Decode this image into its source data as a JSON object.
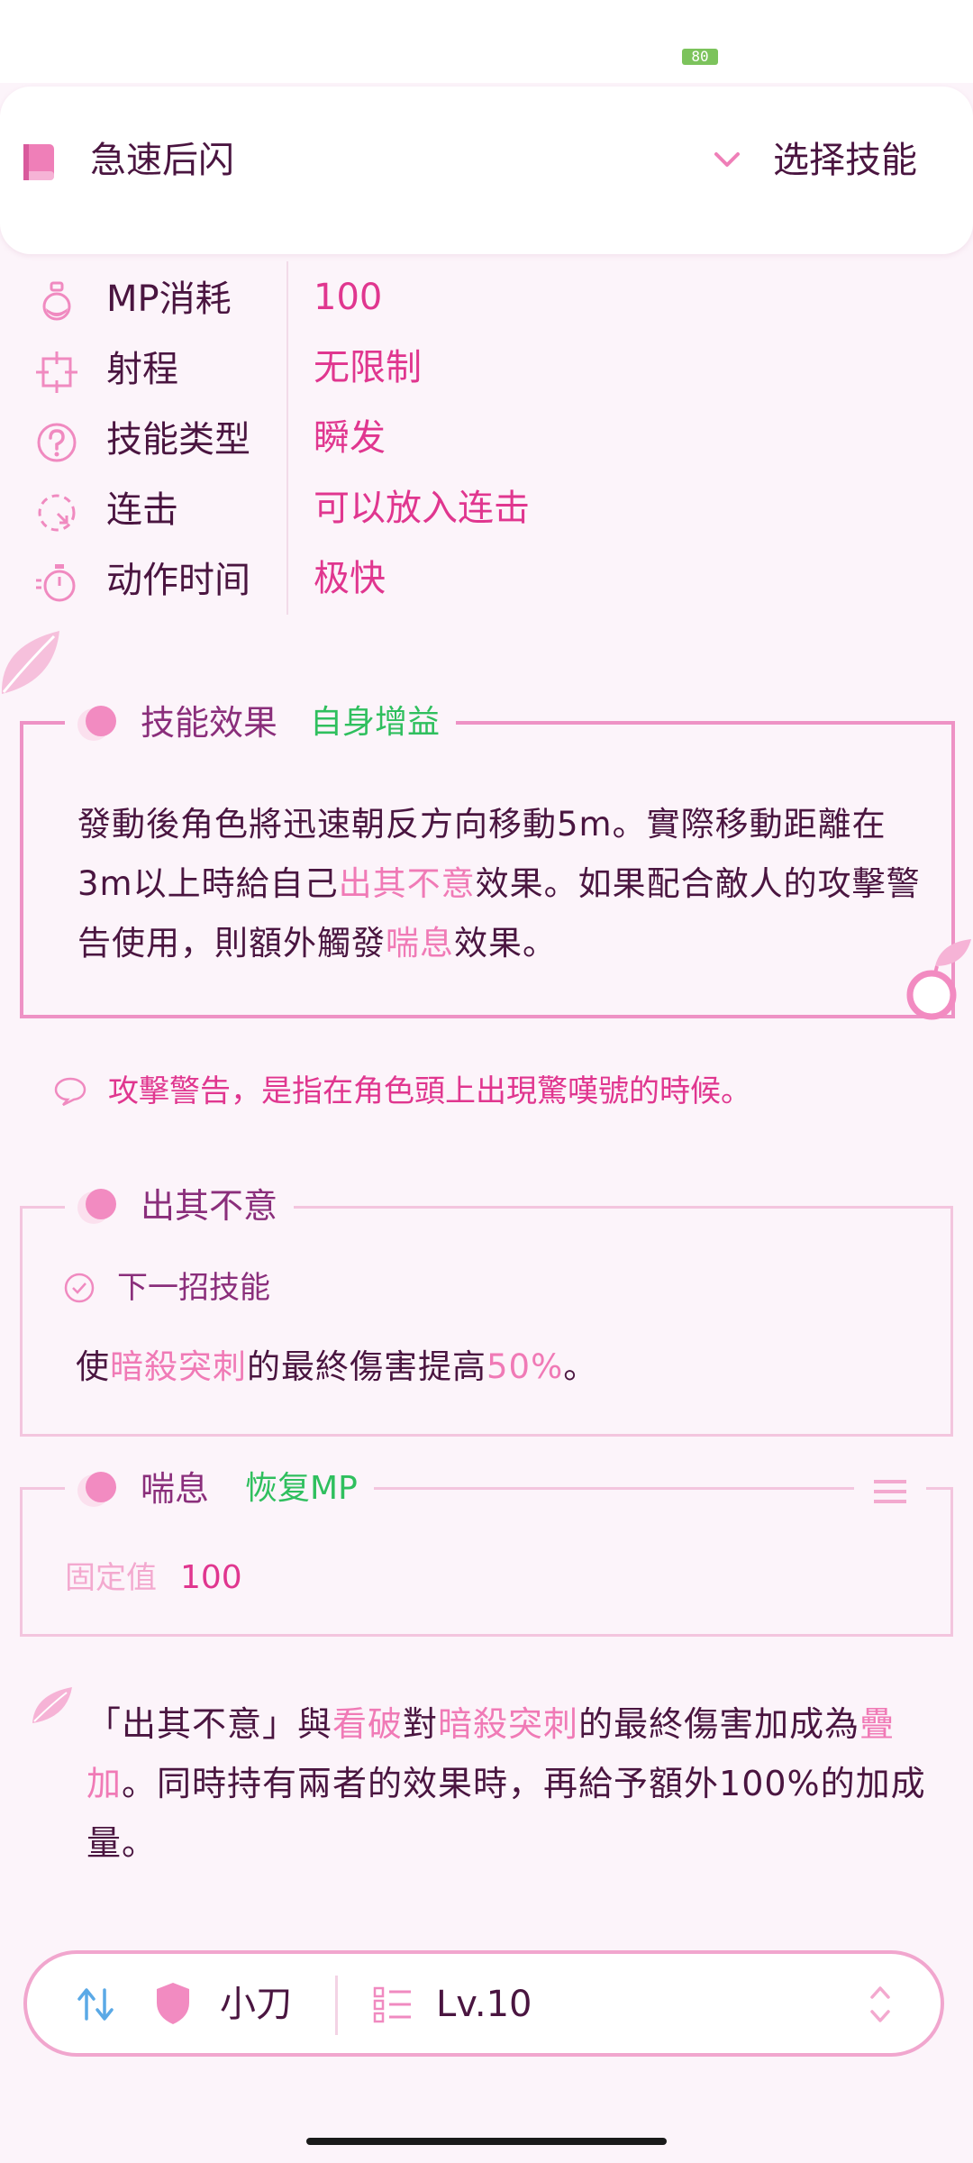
{
  "status": {
    "battery": "80"
  },
  "header": {
    "skill_name": "急速后闪",
    "select_label": "选择技能"
  },
  "properties": [
    {
      "icon": "potion-icon",
      "label": "MP消耗",
      "value": "100"
    },
    {
      "icon": "range-icon",
      "label": "射程",
      "value": "无限制"
    },
    {
      "icon": "question-icon",
      "label": "技能类型",
      "value": "瞬发"
    },
    {
      "icon": "combo-icon",
      "label": "连击",
      "value": "可以放入连击"
    },
    {
      "icon": "stopwatch-icon",
      "label": "动作时间",
      "value": "极快"
    }
  ],
  "effect": {
    "title": "技能效果",
    "tag": "自身增益",
    "text_parts": [
      "發動後角色將迅速朝反方向移動5m。實際移動距離在3m以上時給自己",
      "出其不意",
      "效果。如果配合敵人的攻擊警告使用，則額外觸發",
      "喘息",
      "效果。"
    ]
  },
  "note": "攻擊警告，是指在角色頭上出現驚嘆號的時候。",
  "surprise": {
    "title": "出其不意",
    "condition": "下一招技能",
    "text_parts": [
      "使",
      "暗殺突刺",
      "的最終傷害提高",
      "50%",
      "。"
    ]
  },
  "breather": {
    "title": "喘息",
    "tag": "恢复MP",
    "fixed_label": "固定值",
    "fixed_value": "100"
  },
  "footer": {
    "text_parts": [
      "「出其不意」與",
      "看破",
      "對",
      "暗殺突刺",
      "的最終傷害加成為",
      "疊加",
      "。同時持有兩者的效果時，再給予額外100%的加成量。"
    ]
  },
  "bottom_bar": {
    "weapon": "小刀",
    "level": "Lv.10"
  },
  "colors": {
    "accent": "#e0368f",
    "highlight": "#f07ab6",
    "tag_green": "#2fbf5e",
    "title_purple": "#8a2e7b"
  }
}
